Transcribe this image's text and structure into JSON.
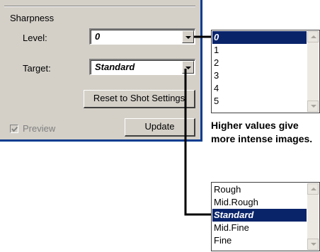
{
  "panel": {
    "section_title": "Sharpness",
    "level_label": "Level:",
    "level_value": "0",
    "target_label": "Target:",
    "target_value": "Standard",
    "reset_button": "Reset to Shot Settings",
    "preview_label": "Preview",
    "preview_checked": true,
    "preview_disabled": true,
    "update_button": "Update"
  },
  "level_list": {
    "items": [
      "0",
      "1",
      "2",
      "3",
      "4",
      "5"
    ],
    "selected": "0"
  },
  "target_list": {
    "items": [
      "Rough",
      "Mid.Rough",
      "Standard",
      "Mid.Fine",
      "Fine"
    ],
    "selected": "Standard"
  },
  "caption": "Higher values give more intense images.",
  "colors": {
    "selection": "#0a246a",
    "panel_bg": "#d4d0c8",
    "frame_border": "#0a3d8f"
  }
}
